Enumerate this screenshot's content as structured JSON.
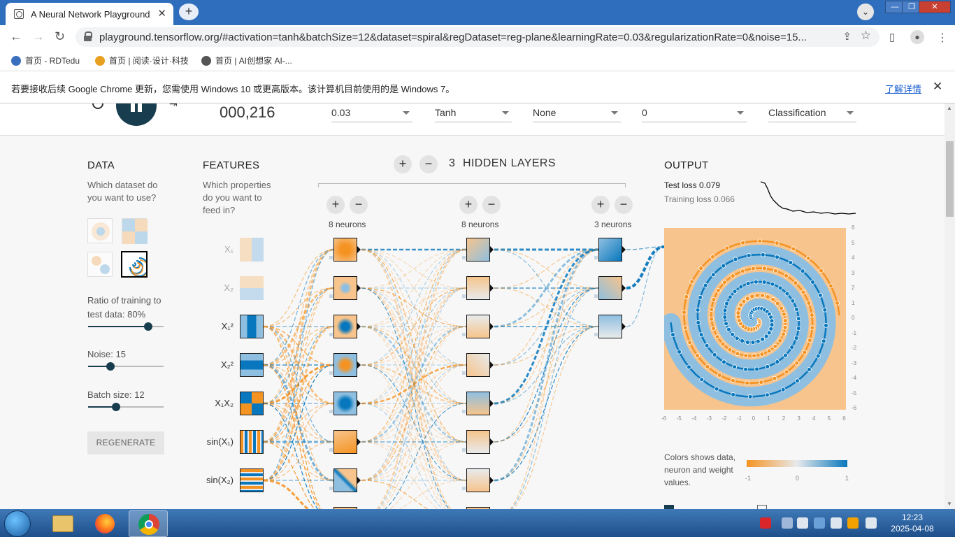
{
  "browser": {
    "tab_title": "A Neural Network Playground",
    "tab_close": "✕",
    "new_tab": "+",
    "url": "playground.tensorflow.org/#activation=tanh&batchSize=12&dataset=spiral&regDataset=reg-plane&learningRate=0.03&regularizationRate=0&noise=15..."
  },
  "bookmarks": [
    {
      "label": "首页 - RDTedu",
      "icon_color": "#3a6fc0"
    },
    {
      "label": "首页 | 阅读·设计·科技",
      "icon_color": "#e8a020"
    },
    {
      "label": "首页 | AI创想家 AI-...",
      "icon_color": "#555555"
    }
  ],
  "infobar": {
    "message": "若要接收后续 Google Chrome 更新，您需使用 Windows 10 或更高版本。该计算机目前使用的是 Windows 7。",
    "link": "了解详情",
    "close": "✕"
  },
  "controls": {
    "epoch": "000,216",
    "learning_rate": "0.03",
    "activation": "Tanh",
    "regularization": "None",
    "regularization_rate": "0",
    "problem_type": "Classification"
  },
  "data_panel": {
    "title": "DATA",
    "question": "Which dataset do you want to use?",
    "ratio_label": "Ratio of training to test data:  80%",
    "ratio_value": 0.8,
    "noise_label": "Noise:  15",
    "noise_value": 0.3,
    "batch_label": "Batch size:  12",
    "batch_value": 0.37,
    "regenerate": "REGENERATE"
  },
  "features_panel": {
    "title": "FEATURES",
    "question": "Which properties do you want to feed in?",
    "features": [
      {
        "label": "X₁",
        "enabled": false
      },
      {
        "label": "X₂",
        "enabled": false
      },
      {
        "label": "X₁²",
        "enabled": true
      },
      {
        "label": "X₂²",
        "enabled": true
      },
      {
        "label": "X₁X₂",
        "enabled": true
      },
      {
        "label": "sin(X₁)",
        "enabled": true
      },
      {
        "label": "sin(X₂)",
        "enabled": true
      }
    ]
  },
  "network": {
    "hidden_layers_count": "3",
    "hidden_layers_label": "HIDDEN LAYERS",
    "layers": [
      {
        "neurons_label": "8 neurons"
      },
      {
        "neurons_label": "8 neurons"
      },
      {
        "neurons_label": "3 neurons"
      }
    ]
  },
  "output_panel": {
    "title": "OUTPUT",
    "test_loss_label": "Test loss",
    "test_loss": "0.079",
    "training_loss_label": "Training loss",
    "training_loss": "0.066",
    "y_ticks": [
      "6",
      "5",
      "4",
      "3",
      "2",
      "1",
      "0",
      "-1",
      "-2",
      "-3",
      "-4",
      "-5",
      "-6"
    ],
    "x_ticks": [
      "-6",
      "-5",
      "-4",
      "-3",
      "-2",
      "-1",
      "0",
      "1",
      "2",
      "3",
      "4",
      "5",
      "6"
    ],
    "legend_text": "Colors shows data, neuron and weight values.",
    "legend_ticks": [
      "-1",
      "0",
      "1"
    ]
  },
  "colors": {
    "orange": "#f59322",
    "blue": "#0877bd",
    "light_orange": "#f6c48c",
    "light_blue": "#8fbfe0",
    "dark": "#183d4e"
  },
  "taskbar": {
    "time": "12:23",
    "date": "2025-04-08"
  }
}
